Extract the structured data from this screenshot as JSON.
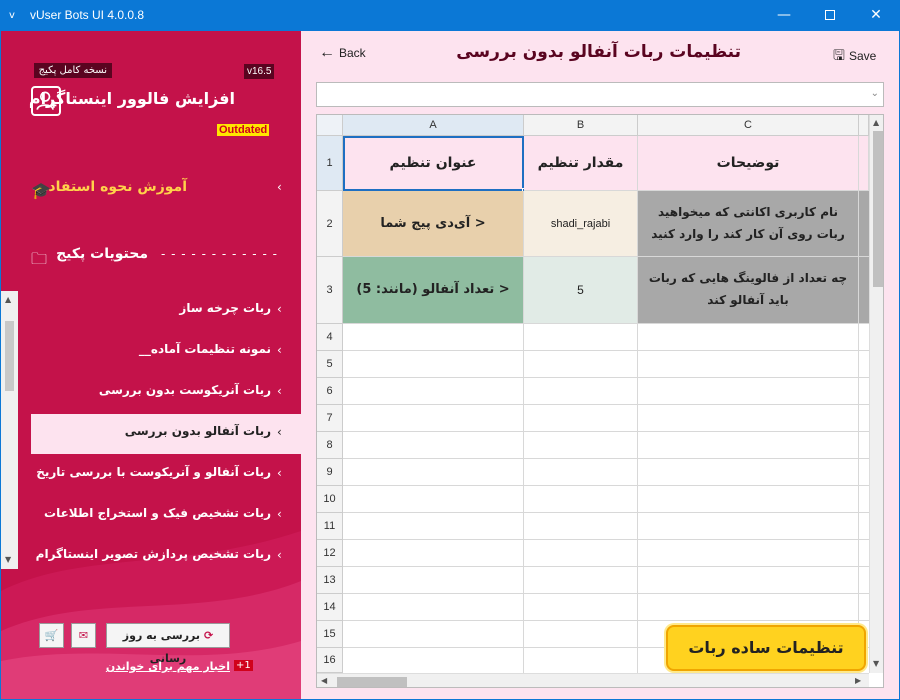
{
  "window": {
    "title": "vUser Bots UI 4.0.0.8",
    "app_icon": "v",
    "minimize": "—",
    "close": "✕"
  },
  "sidebar": {
    "package_badge": "نسخه کامل پکیج",
    "version": "v16.5",
    "app_title": "افزایش فالوور اینستاگرام",
    "outdated_label": "Outdated",
    "tutorial_label": "آموزش نحوه استفاده",
    "package_contents_label": "محتویات پکیج",
    "items": [
      {
        "label": "ربات چرخه ساز"
      },
      {
        "label": "نمونه تنظیمات آماده__"
      },
      {
        "label": "ربات آنریکوست بدون بررسی"
      },
      {
        "label": "ربات آنفالو بدون بررسی",
        "active": true
      },
      {
        "label": "ربات آنفالو و آنریکوست با بررسی تاریخ"
      },
      {
        "label": "ربات تشخیص فیک و استخراج اطلاعات"
      },
      {
        "label": "ربات تشخیص پردازش تصویر اینستاگرام"
      }
    ],
    "update_button": "بررسی به روز رسانی",
    "news_link": "اخبار مهم برای خواندن",
    "news_count": "+1"
  },
  "main": {
    "back_label": "Back",
    "title": "تنظیمات ربات آنفالو بدون بررسی",
    "save_label": "Save",
    "simple_settings_button": "تنظیمات ساده ربات"
  },
  "sheet": {
    "columns": [
      "A",
      "B",
      "C"
    ],
    "row_numbers": [
      "1",
      "2",
      "3",
      "4",
      "5",
      "6",
      "7",
      "8",
      "9",
      "10",
      "11",
      "12",
      "13",
      "14",
      "15",
      "16"
    ],
    "headers": {
      "a": "عنوان تنظیم",
      "b": "مقدار تنظیم",
      "c": "توضیحات"
    },
    "rows": [
      {
        "a": "< آی‌دی پیج شما",
        "b": "shadi_rajabi",
        "c": "نام کاربری اکانتی که میخواهید ربات روی آن کار کند را وارد کنید"
      },
      {
        "a": "< تعداد آنفالو (مانند: 5)",
        "b": "5",
        "c": "چه تعداد از فالوینگ هایی که ربات باید آنفالو کند"
      }
    ]
  }
}
